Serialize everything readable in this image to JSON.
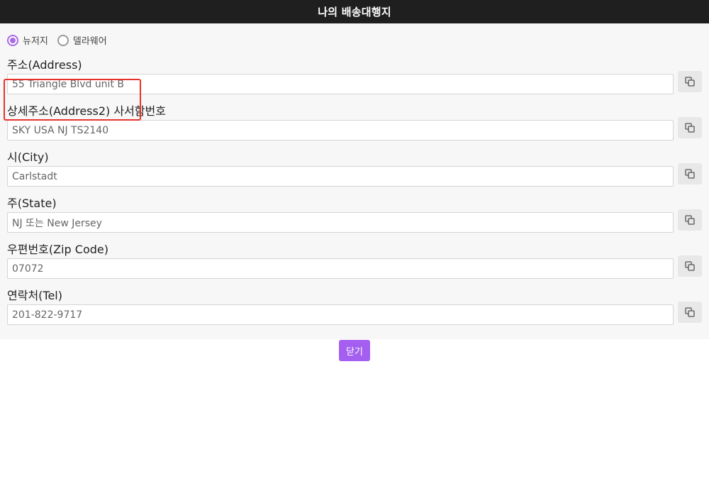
{
  "header": {
    "title": "나의 배송대행지"
  },
  "location_options": [
    {
      "label": "뉴저지",
      "selected": true
    },
    {
      "label": "델라웨어",
      "selected": false
    }
  ],
  "fields": [
    {
      "label": "주소(Address)",
      "value": "55 Triangle Blvd unit B"
    },
    {
      "label": "상세주소(Address2) 사서함번호",
      "value": "SKY USA NJ TS2140"
    },
    {
      "label": "시(City)",
      "value": "Carlstadt"
    },
    {
      "label": "주(State)",
      "value": "NJ 또는 New Jersey"
    },
    {
      "label": "우편번호(Zip Code)",
      "value": "07072"
    },
    {
      "label": "연락처(Tel)",
      "value": "201-822-9717"
    }
  ],
  "close_label": "닫기",
  "colors": {
    "accent": "#a45ff0",
    "header_bg": "#1f1f1f",
    "highlight": "#e8332b"
  },
  "icons": {
    "copy": "copy-icon"
  }
}
